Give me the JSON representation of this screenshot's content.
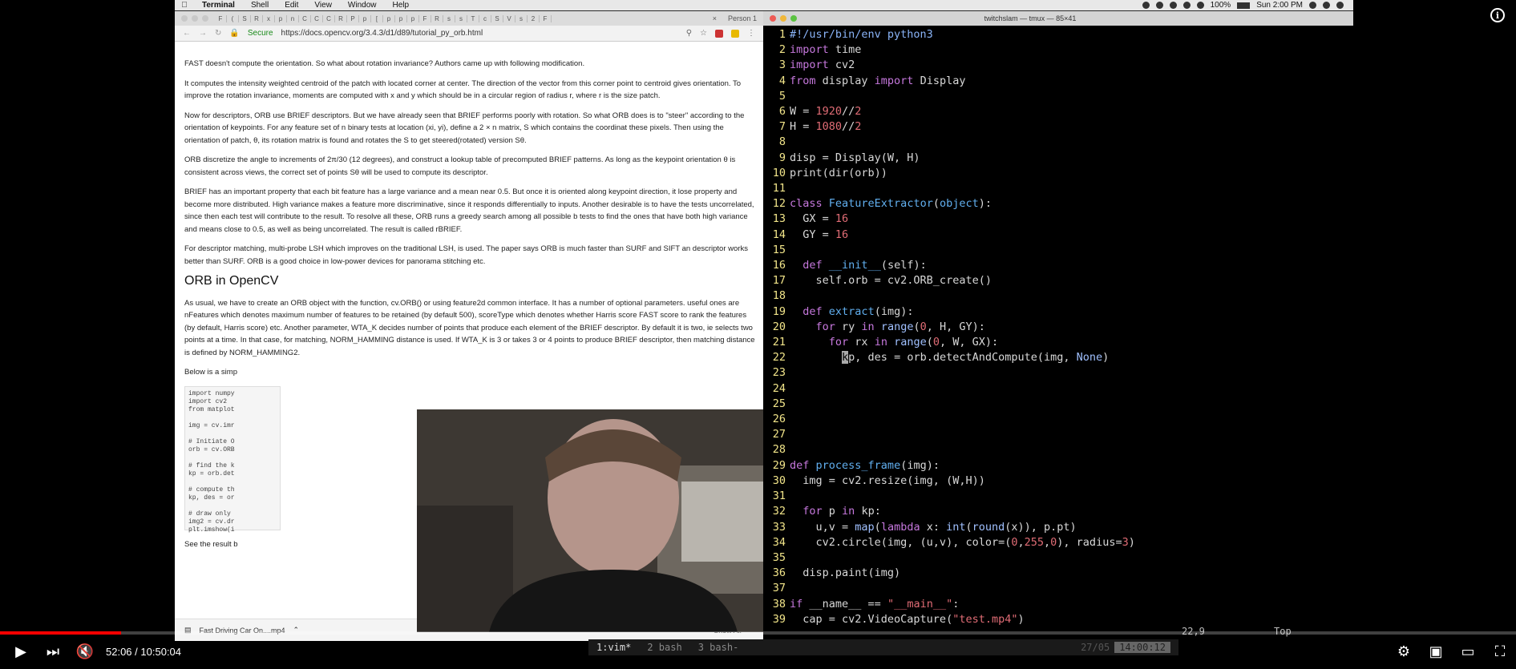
{
  "menubar": {
    "app": "Terminal",
    "items": [
      "Shell",
      "Edit",
      "View",
      "Window",
      "Help"
    ],
    "battery": "100%",
    "clock": "Sun 2:00 PM"
  },
  "browser": {
    "tab_labels": [
      "F",
      "(",
      "S",
      "R",
      "x",
      "p",
      "n",
      "C",
      "C",
      "C",
      "R",
      "P",
      "p",
      "[",
      "p",
      "p",
      "p",
      "F",
      "R",
      "s",
      "s",
      "T",
      "c",
      "S",
      "V",
      "s",
      "2",
      "F"
    ],
    "profile": "Person 1",
    "secure": "Secure",
    "url": "https://docs.opencv.org/3.4.3/d1/d89/tutorial_py_orb.html",
    "paragraphs": [
      "FAST doesn't compute the orientation. So what about rotation invariance? Authors came up with following modification.",
      "It computes the intensity weighted centroid of the patch with located corner at center. The direction of the vector from this corner point to centroid gives orientation. To improve the rotation invariance, moments are computed with x and y which should be in a circular region of radius r, where r is the size patch.",
      "Now for descriptors, ORB use BRIEF descriptors. But we have already seen that BRIEF performs poorly with rotation. So what ORB does is to \"steer\" according to the orientation of keypoints. For any feature set of n binary tests at location (xi, yi), define a 2 × n matrix, S which contains the coordinat these pixels. Then using the orientation of patch, θ, its rotation matrix is found and rotates the S to get steered(rotated) version Sθ.",
      "ORB discretize the angle to increments of 2π/30 (12 degrees), and construct a lookup table of precomputed BRIEF patterns. As long as the keypoint orientation θ is consistent across views, the correct set of points Sθ will be used to compute its descriptor.",
      "BRIEF has an important property that each bit feature has a large variance and a mean near 0.5. But once it is oriented along keypoint direction, it lose property and become more distributed. High variance makes a feature more discriminative, since it responds differentially to inputs. Another desirable is to have the tests uncorrelated, since then each test will contribute to the result. To resolve all these, ORB runs a greedy search among all possible b tests to find the ones that have both high variance and means close to 0.5, as well as being uncorrelated. The result is called rBRIEF.",
      "For descriptor matching, multi-probe LSH which improves on the traditional LSH, is used. The paper says ORB is much faster than SURF and SIFT an descriptor works better than SURF. ORB is a good choice in low-power devices for panorama stitching etc."
    ],
    "heading": "ORB in OpenCV",
    "paragraph_after": "As usual, we have to create an ORB object with the function, cv.ORB() or using feature2d common interface. It has a number of optional parameters. useful ones are nFeatures which denotes maximum number of features to be retained (by default 500), scoreType which denotes whether Harris score FAST score to rank the features (by default, Harris score) etc. Another parameter, WTA_K decides number of points that produce each element of the BRIEF descriptor. By default it is two, ie selects two points at a time. In that case, for matching, NORM_HAMMING distance is used. If WTA_K is 3 or takes 3 or 4 points to produce BRIEF descriptor, then matching distance is defined by NORM_HAMMING2.",
    "simple_intro": "Below is a simp",
    "code_snippet": "import numpy\nimport cv2\nfrom matplot\n\nimg = cv.imr\n\n# Initiate O\norb = cv.ORB\n\n# find the k\nkp = orb.det\n\n# compute th\nkp, des = or\n\n# draw only\nimg2 = cv.dr\nplt.imshow(i",
    "see_result": "See the result b",
    "download_file": "Fast Driving Car On....mp4",
    "show_all": "Show All"
  },
  "terminal": {
    "title": "twitchslam — tmux — 85×41",
    "cursor_position": "22,9",
    "scroll_position": "Top",
    "tmux_windows": [
      "1:vim*",
      "2 bash",
      "3 bash-"
    ],
    "tmux_date": "27/05",
    "tmux_time": "14:00:12"
  },
  "player": {
    "time_current": "52:06",
    "time_total": "10:50:04",
    "progress": 0.0801
  }
}
